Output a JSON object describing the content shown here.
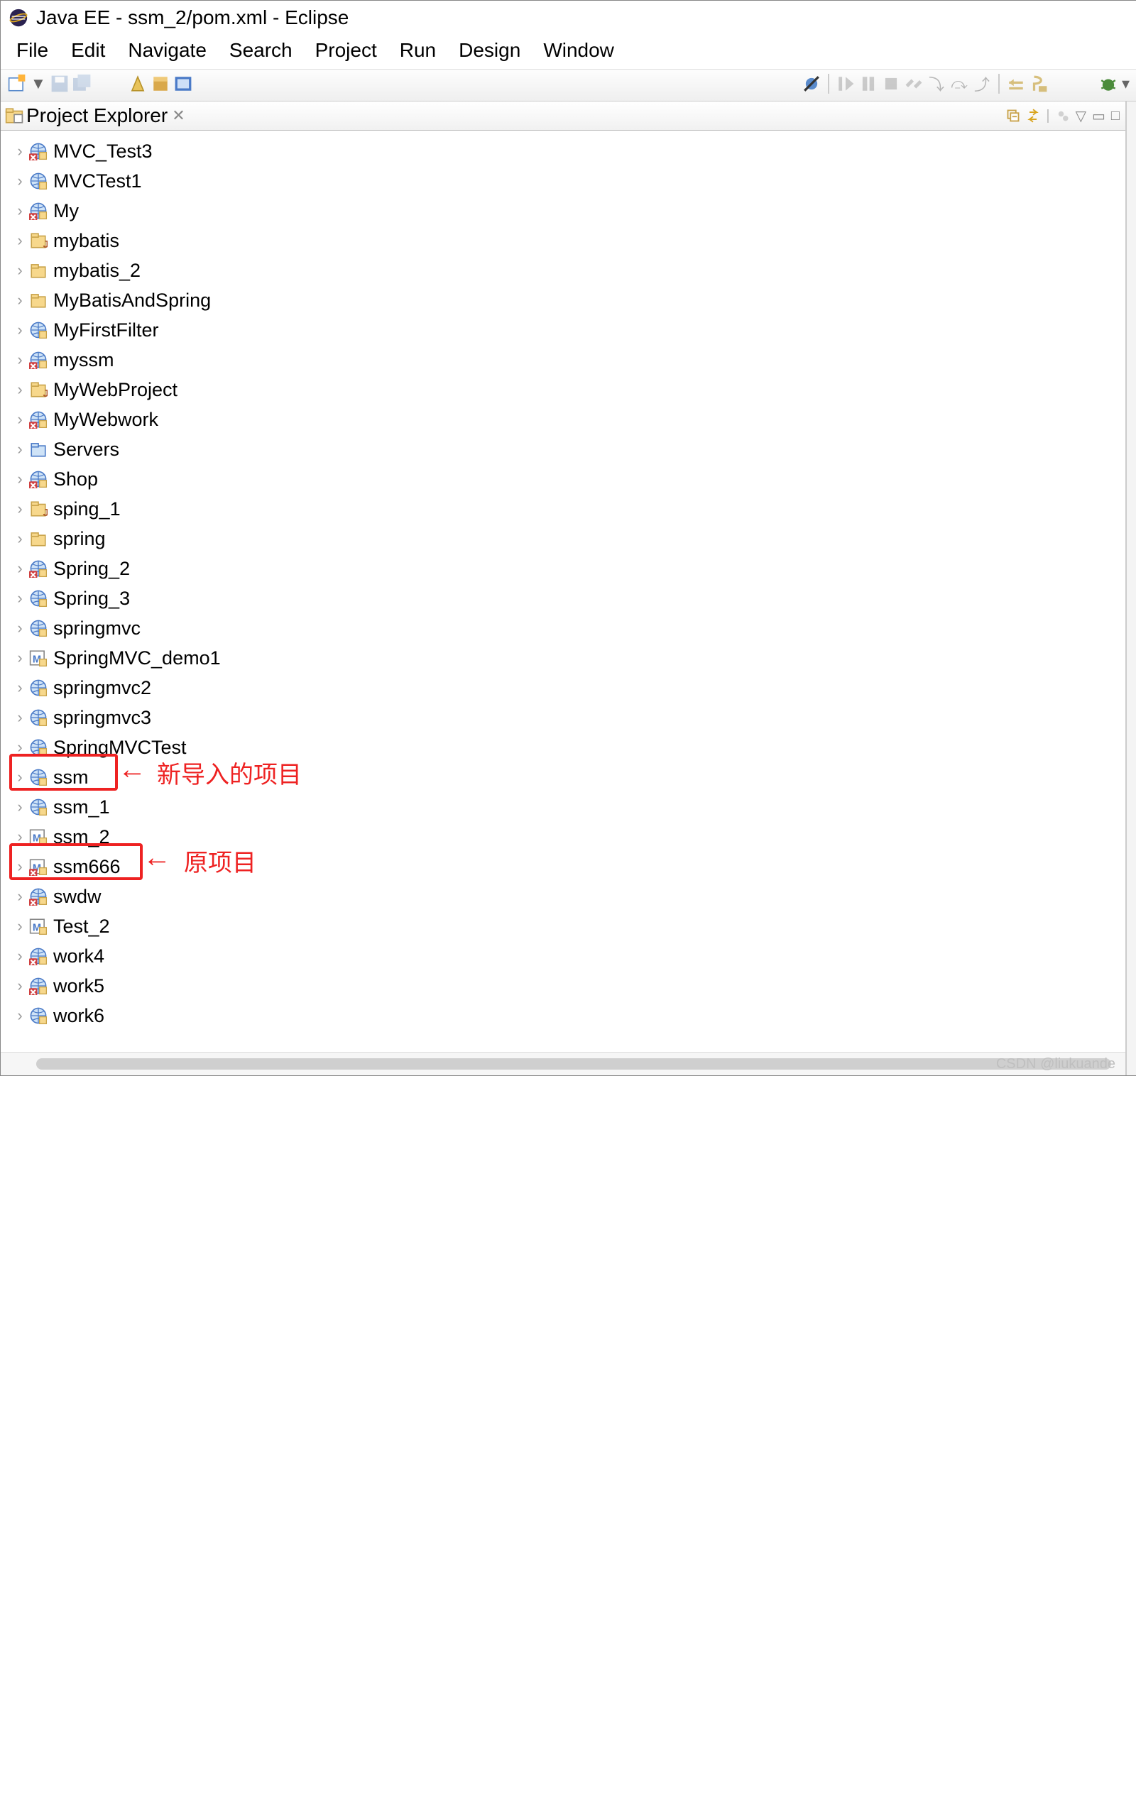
{
  "title": "Java EE - ssm_2/pom.xml - Eclipse",
  "menu": [
    "File",
    "Edit",
    "Navigate",
    "Search",
    "Project",
    "Run",
    "Design",
    "Window"
  ],
  "explorer": {
    "title": "Project Explorer",
    "items": [
      {
        "name": "MVC_Test3",
        "icon": "web-err"
      },
      {
        "name": "MVCTest1",
        "icon": "web"
      },
      {
        "name": "My",
        "icon": "web-err"
      },
      {
        "name": "mybatis",
        "icon": "java"
      },
      {
        "name": "mybatis_2",
        "icon": "folder"
      },
      {
        "name": "MyBatisAndSpring",
        "icon": "folder"
      },
      {
        "name": "MyFirstFilter",
        "icon": "web"
      },
      {
        "name": "myssm",
        "icon": "web-err"
      },
      {
        "name": "MyWebProject",
        "icon": "java"
      },
      {
        "name": "MyWebwork",
        "icon": "web-err"
      },
      {
        "name": "Servers",
        "icon": "server"
      },
      {
        "name": "Shop",
        "icon": "web-err"
      },
      {
        "name": "sping_1",
        "icon": "java"
      },
      {
        "name": "spring",
        "icon": "folder"
      },
      {
        "name": "Spring_2",
        "icon": "web-err"
      },
      {
        "name": "Spring_3",
        "icon": "web"
      },
      {
        "name": "springmvc",
        "icon": "web"
      },
      {
        "name": "SpringMVC_demo1",
        "icon": "maven"
      },
      {
        "name": "springmvc2",
        "icon": "web"
      },
      {
        "name": "springmvc3",
        "icon": "web"
      },
      {
        "name": "SpringMVCTest",
        "icon": "web"
      },
      {
        "name": "ssm",
        "icon": "web"
      },
      {
        "name": "ssm_1",
        "icon": "web"
      },
      {
        "name": "ssm_2",
        "icon": "maven"
      },
      {
        "name": "ssm666",
        "icon": "maven-err"
      },
      {
        "name": "swdw",
        "icon": "web-err"
      },
      {
        "name": "Test_2",
        "icon": "maven"
      },
      {
        "name": "work4",
        "icon": "web-err"
      },
      {
        "name": "work5",
        "icon": "web-err"
      },
      {
        "name": "work6",
        "icon": "web"
      }
    ]
  },
  "annotations": {
    "ssm_note": "新导入的项目",
    "ssm666_note": "原项目"
  },
  "watermark": "CSDN @liukuande"
}
